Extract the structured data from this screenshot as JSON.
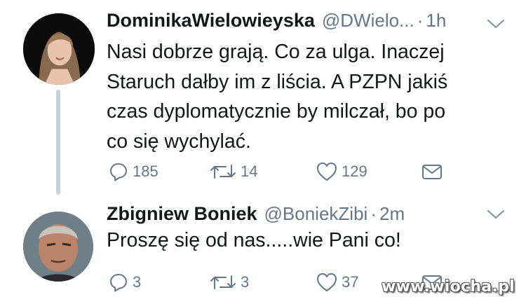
{
  "tweets": [
    {
      "name": "DominikaWielowieyska",
      "handle": "@DWielo...",
      "separator": "·",
      "time": "1h",
      "text": "Nasi dobrze grają. Co za ulga. Inaczej\nStaruch dałby im z liścia. A PZPN jakiś\nczas dyplomatycznie by milczał, bo po\nco się wychylać.",
      "replies": "185",
      "retweets": "14",
      "likes": "129"
    },
    {
      "name": "Zbigniew Boniek",
      "handle": "@BoniekZibi",
      "separator": "·",
      "time": "2m",
      "text": "Proszę się od nas.....wie Pani co!",
      "replies": "3",
      "retweets": "3",
      "likes": "37"
    }
  ],
  "watermark": "www.wiocha.pl",
  "colors": {
    "text": "#14171a",
    "secondary": "#657786",
    "thread_line": "#c9d1d8",
    "background": "#ffffff"
  },
  "icons": [
    "reply-icon",
    "retweet-icon",
    "like-icon",
    "direct-message-icon",
    "chevron-down-icon"
  ]
}
